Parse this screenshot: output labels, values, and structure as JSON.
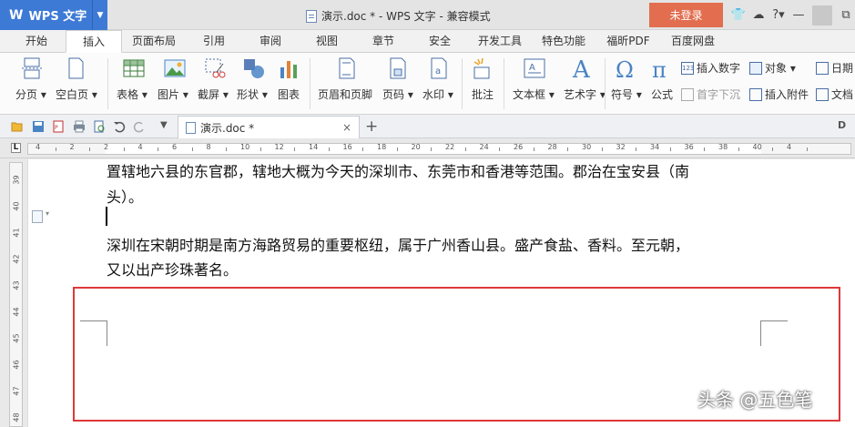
{
  "titlebar": {
    "app_name": "WPS 文字",
    "logo": "W",
    "doc_title": "演示.doc * - WPS 文字 - 兼容模式",
    "login_label": "未登录",
    "icons": [
      "shirt-icon",
      "skin-icon",
      "help-icon",
      "minimize-icon",
      "restore-icon"
    ]
  },
  "tabs": [
    "开始",
    "插入",
    "页面布局",
    "引用",
    "审阅",
    "视图",
    "章节",
    "安全",
    "开发工具",
    "特色功能",
    "福昕PDF",
    "百度网盘"
  ],
  "active_tab": "插入",
  "ribbon": {
    "break_page": "分页",
    "blank_page": "空白页",
    "table": "表格",
    "picture": "图片",
    "screenshot": "截屏",
    "shape": "形状",
    "chart": "图表",
    "header_footer": "页眉和页脚",
    "page_number": "页码",
    "watermark": "水印",
    "comment": "批注",
    "textbox": "文本框",
    "wordart": "艺术字",
    "symbol": "符号",
    "formula": "公式",
    "insert_number": "插入数字",
    "drop_cap": "首字下沉",
    "object": "对象",
    "attachment": "插入附件",
    "date": "日期",
    "doc_part": "文档"
  },
  "quickbar": {
    "doc_tab": "演示.doc *",
    "close": "×",
    "add": "+"
  },
  "ruler": {
    "h_numbers": [
      "4",
      "2",
      "2",
      "4",
      "6",
      "8",
      "10",
      "12",
      "14",
      "16",
      "18",
      "20",
      "22",
      "24",
      "26",
      "28",
      "30",
      "32",
      "34",
      "36",
      "38",
      "40",
      "4"
    ],
    "v_numbers": [
      "39",
      "40",
      "41",
      "42",
      "43",
      "44",
      "45",
      "46",
      "47",
      "48"
    ]
  },
  "document": {
    "line1": "置辖地六县的东官郡，辖地大概为今天的深圳市、东莞市和香港等范围。郡治在宝安县（南",
    "line2": "头）。",
    "line3": "深圳在宋朝时期是南方海路贸易的重要枢纽，属于广州香山县。盛产食盐、香料。至元朝，",
    "line4": "又以出产珍珠著名。"
  },
  "watermark_text": "头条 @五色笔",
  "colors": {
    "wps_blue": "#3d7ad6",
    "login_red": "#e26e4f",
    "highlight_red": "#e03838"
  }
}
